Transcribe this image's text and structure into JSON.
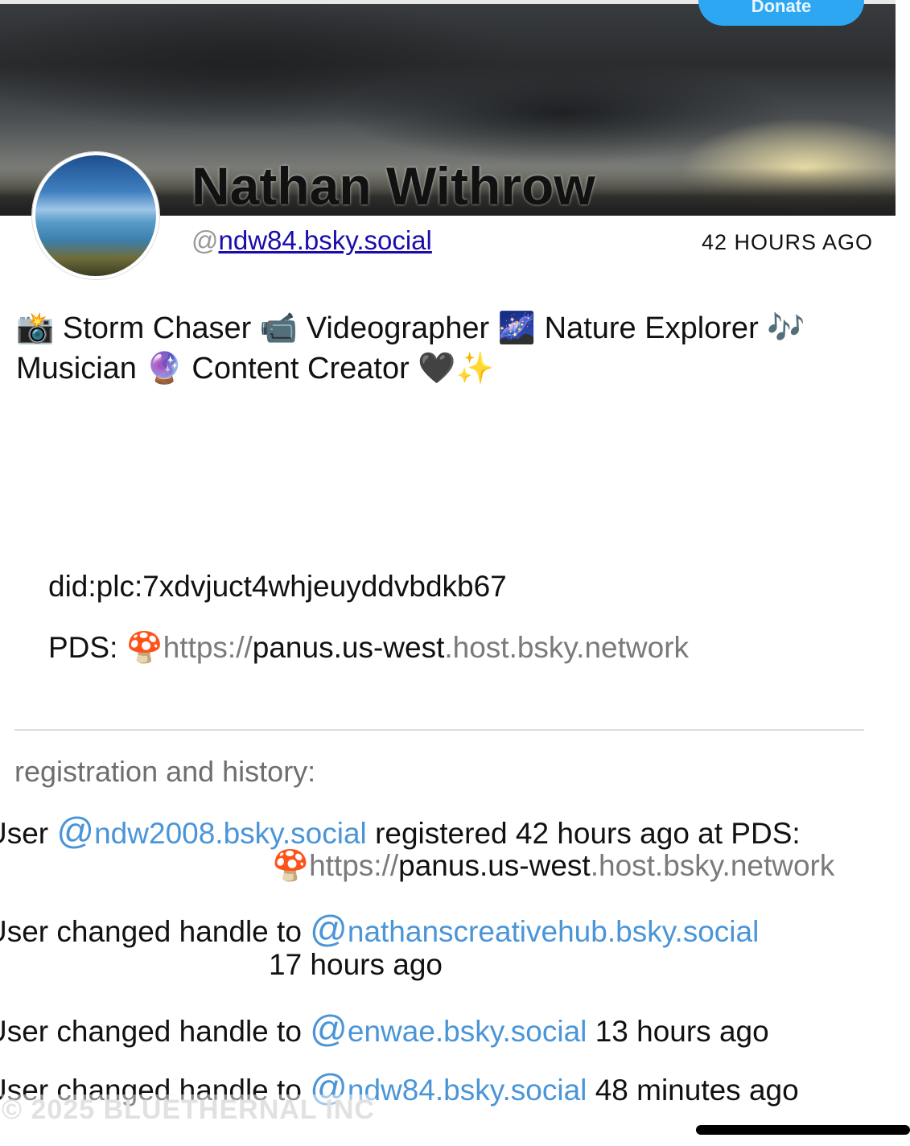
{
  "top_button": {
    "label": "Donate"
  },
  "profile": {
    "display_name": "Nathan Withrow",
    "handle_prefix": "@",
    "handle": "ndw84.bsky.social",
    "time_ago": "42 HOURS AGO",
    "bio": "📸 Storm Chaser 📹 Videographer 🌌 Nature Explorer 🎶 Musician 🔮 Content Creator 🖤✨"
  },
  "identity": {
    "did": "did:plc:7xdvjuct4whjeuyddvbdkb67",
    "pds_label": "PDS:",
    "pds_emoji": "🍄",
    "pds_scheme": "https://",
    "pds_host": "panus.us-west",
    "pds_domain": ".host.bsky.network"
  },
  "history": {
    "heading": "registration and history:",
    "entries": [
      {
        "prefix": "User",
        "at": "@",
        "handle": "ndw2008.bsky.social",
        "text": "registered 42 hours ago  at PDS:",
        "pds_emoji": "🍄",
        "pds_scheme": "https://",
        "pds_host": "panus.us-west",
        "pds_domain": ".host.bsky.network"
      },
      {
        "prefix": "User changed handle to",
        "at": "@",
        "handle": "nathanscreativehub.bsky.social",
        "time": "17 hours ago"
      },
      {
        "prefix": "User changed handle to",
        "at": "@",
        "handle": "enwae.bsky.social",
        "time": "13 hours ago"
      },
      {
        "prefix": "User changed handle to",
        "at": "@",
        "handle": "ndw84.bsky.social",
        "time": "48 minutes ago"
      }
    ]
  },
  "footer": {
    "copyright": "© 2025 BLUETHERNAL INC"
  },
  "colors": {
    "link": "#4a95d8",
    "handle_link": "#1a0dab",
    "button": "#2ea7f3"
  }
}
